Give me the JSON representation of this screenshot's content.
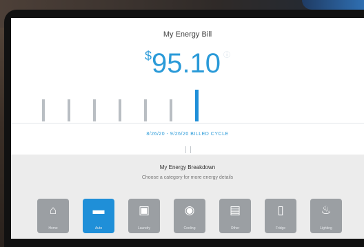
{
  "bill": {
    "title": "My Energy Bill",
    "currency_symbol": "$",
    "amount": "95.10",
    "info_glyph": "ⓘ",
    "date_range": "8/26/20 - 9/26/20 BILLED CYCLE"
  },
  "usage_bars": {
    "count": 7,
    "selected_index": 6
  },
  "breakdown": {
    "title": "My Energy Breakdown",
    "subtitle": "Choose a category for more energy details",
    "categories": [
      {
        "icon": "house-icon",
        "glyph": "⌂",
        "label": "Home",
        "selected": false
      },
      {
        "icon": "car-icon",
        "glyph": "▬",
        "label": "Auto",
        "selected": true
      },
      {
        "icon": "washer-icon",
        "glyph": "▣",
        "label": "Laundry",
        "selected": false
      },
      {
        "icon": "fan-icon",
        "glyph": "◉",
        "label": "Cooling",
        "selected": false
      },
      {
        "icon": "document-icon",
        "glyph": "▤",
        "label": "Other",
        "selected": false
      },
      {
        "icon": "fridge-icon",
        "glyph": "▯",
        "label": "Fridge",
        "selected": false
      },
      {
        "icon": "lightbulb-icon",
        "glyph": "♨",
        "label": "Lighting",
        "selected": false
      }
    ]
  },
  "colors": {
    "accent": "#1f8fd8",
    "tile_inactive": "#9b9fa3"
  }
}
